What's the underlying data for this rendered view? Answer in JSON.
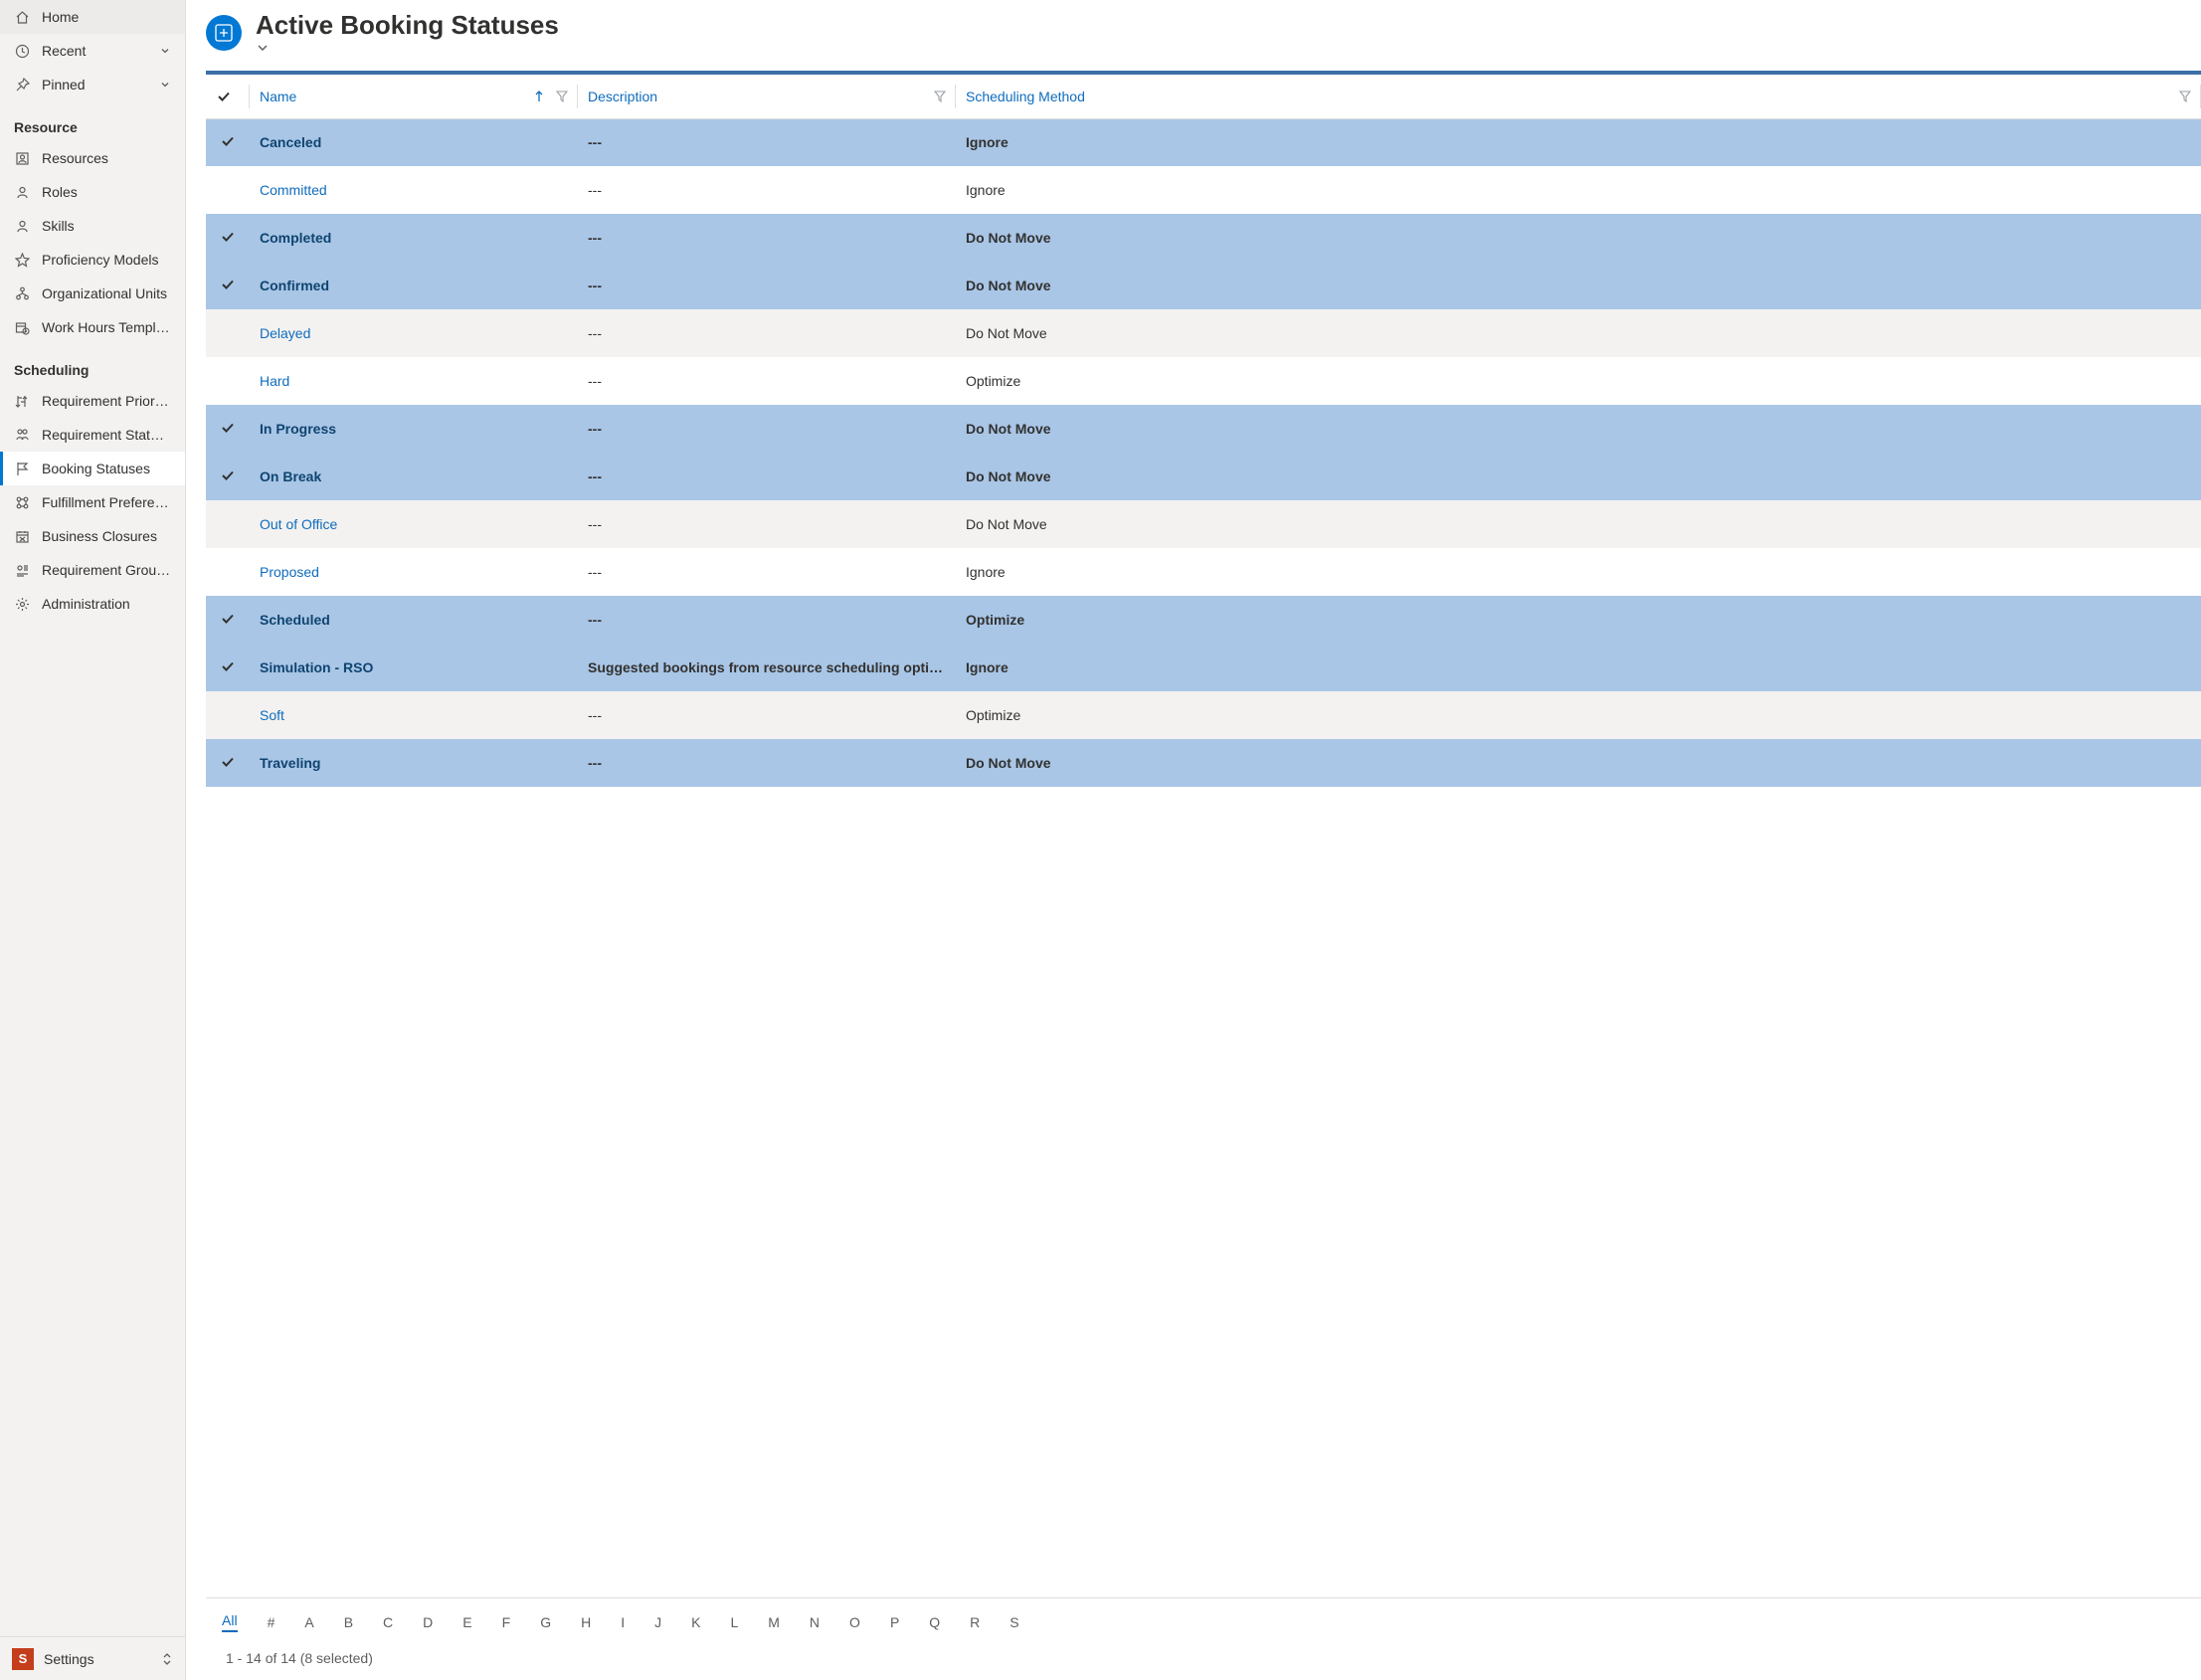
{
  "sidebar": {
    "top": [
      {
        "icon": "home-icon",
        "label": "Home",
        "expandable": false
      },
      {
        "icon": "clock-icon",
        "label": "Recent",
        "expandable": true
      },
      {
        "icon": "pin-icon",
        "label": "Pinned",
        "expandable": true
      }
    ],
    "sections": [
      {
        "title": "Resource",
        "items": [
          {
            "icon": "resource-icon",
            "label": "Resources"
          },
          {
            "icon": "person-icon",
            "label": "Roles"
          },
          {
            "icon": "person-icon",
            "label": "Skills"
          },
          {
            "icon": "star-icon",
            "label": "Proficiency Models"
          },
          {
            "icon": "org-icon",
            "label": "Organizational Units"
          },
          {
            "icon": "calendar-clock-icon",
            "label": "Work Hours Templates"
          }
        ]
      },
      {
        "title": "Scheduling",
        "items": [
          {
            "icon": "priority-icon",
            "label": "Requirement Priorities"
          },
          {
            "icon": "status-icon",
            "label": "Requirement Statuses"
          },
          {
            "icon": "flag-icon",
            "label": "Booking Statuses",
            "active": true
          },
          {
            "icon": "pref-icon",
            "label": "Fulfillment Preferences"
          },
          {
            "icon": "closure-icon",
            "label": "Business Closures"
          },
          {
            "icon": "group-icon",
            "label": "Requirement Group …"
          },
          {
            "icon": "gear-icon",
            "label": "Administration"
          }
        ]
      }
    ],
    "area": {
      "badge": "S",
      "label": "Settings"
    }
  },
  "view": {
    "title": "Active Booking Statuses"
  },
  "columns": {
    "name": "Name",
    "description": "Description",
    "method": "Scheduling Method"
  },
  "rows": [
    {
      "selected": true,
      "name": "Canceled",
      "description": "---",
      "method": "Ignore"
    },
    {
      "selected": false,
      "name": "Committed",
      "description": "---",
      "method": "Ignore"
    },
    {
      "selected": true,
      "name": "Completed",
      "description": "---",
      "method": "Do Not Move"
    },
    {
      "selected": true,
      "name": "Confirmed",
      "description": "---",
      "method": "Do Not Move"
    },
    {
      "selected": false,
      "name": "Delayed",
      "description": "---",
      "method": "Do Not Move"
    },
    {
      "selected": false,
      "name": "Hard",
      "description": "---",
      "method": "Optimize"
    },
    {
      "selected": true,
      "name": "In Progress",
      "description": "---",
      "method": "Do Not Move"
    },
    {
      "selected": true,
      "name": "On Break",
      "description": "---",
      "method": "Do Not Move"
    },
    {
      "selected": false,
      "name": "Out of Office",
      "description": "---",
      "method": "Do Not Move"
    },
    {
      "selected": false,
      "name": "Proposed",
      "description": "---",
      "method": "Ignore"
    },
    {
      "selected": true,
      "name": "Scheduled",
      "description": "---",
      "method": "Optimize"
    },
    {
      "selected": true,
      "name": "Simulation - RSO",
      "description": "Suggested bookings from resource scheduling optimiz…",
      "method": "Ignore"
    },
    {
      "selected": false,
      "name": "Soft",
      "description": "---",
      "method": "Optimize"
    },
    {
      "selected": true,
      "name": "Traveling",
      "description": "---",
      "method": "Do Not Move"
    }
  ],
  "alpha": [
    "All",
    "#",
    "A",
    "B",
    "C",
    "D",
    "E",
    "F",
    "G",
    "H",
    "I",
    "J",
    "K",
    "L",
    "M",
    "N",
    "O",
    "P",
    "Q",
    "R",
    "S"
  ],
  "alpha_active": "All",
  "status_line": "1 - 14 of 14 (8 selected)"
}
